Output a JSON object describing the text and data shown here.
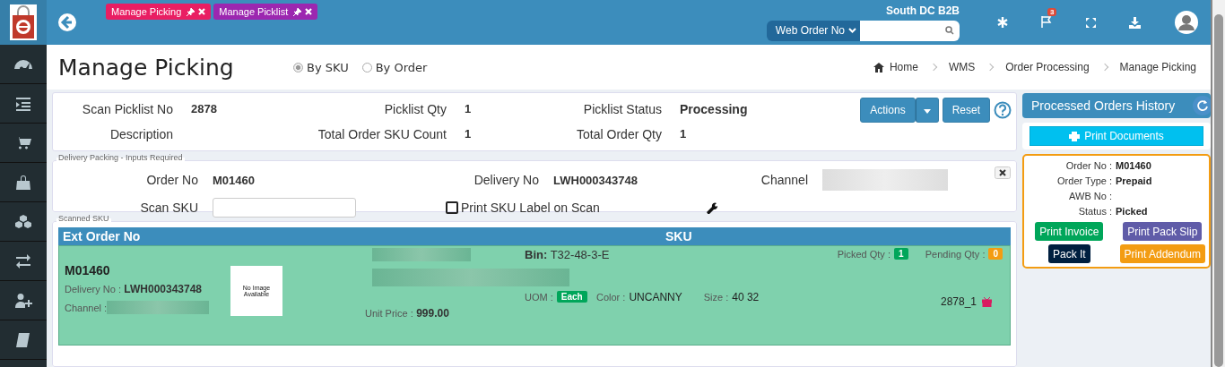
{
  "topbar": {
    "tabs": [
      {
        "label": "Manage Picking",
        "color": "#e91e63"
      },
      {
        "label": "Manage Picklist",
        "color": "#9c27b0"
      }
    ],
    "location": "South DC B2B",
    "search_type": "Web Order No",
    "notifications": "3"
  },
  "page_title": "Manage Picking",
  "mode": [
    {
      "label": "By SKU",
      "selected": true
    },
    {
      "label": "By Order",
      "selected": false
    }
  ],
  "breadcrumb": [
    "Home",
    "WMS",
    "Order Processing",
    "Manage Picking"
  ],
  "picklist": {
    "fields": [
      {
        "label": "Scan Picklist No",
        "value": "2878"
      },
      {
        "label": "Picklist Qty",
        "value": "1"
      },
      {
        "label": "Picklist Status",
        "value": "Processing"
      },
      {
        "label": "Description"
      },
      {
        "label": "Total Order SKU Count",
        "value": "1"
      },
      {
        "label": "Total Order Qty",
        "value": "1"
      }
    ],
    "actions": "Actions",
    "reset": "Reset"
  },
  "delivery": {
    "legend": "Delivery Packing - Inputs Required",
    "order_no_label": "Order No",
    "order_no": "M01460",
    "delivery_no_label": "Delivery No",
    "delivery_no": "LWH000343748",
    "channel_label": "Channel",
    "scan_sku_label": "Scan SKU",
    "print_label": {
      "label": "Print SKU Label on Scan",
      "checked": false
    }
  },
  "scanned": {
    "legend": "Scanned SKU",
    "columns": [
      "Ext Order No",
      "SKU"
    ],
    "row": {
      "order_no": "M01460",
      "delivery_label": "Delivery No :",
      "delivery_no": "LWH000343748",
      "channel_label": "Channel :",
      "image_text": "No Image Available",
      "bin_label": "Bin:",
      "bin": "T32-48-3-E",
      "uom_label": "UOM :",
      "uom": "Each",
      "price_label": "Unit Price :",
      "price": "999.00",
      "color_label": "Color :",
      "color_value": "UNCANNY",
      "size_label": "Size :",
      "size": "40 32",
      "picked_label": "Picked Qty :",
      "picked": "1",
      "pending_label": "Pending Qty :",
      "pending": "0",
      "ref": "2878_1"
    }
  },
  "history": {
    "title": "Processed Orders History",
    "print_documents": "Print Documents",
    "fields": [
      {
        "label": "Order No :",
        "value": "M01460"
      },
      {
        "label": "Order Type :",
        "value": "Prepaid"
      },
      {
        "label": "AWB No :"
      },
      {
        "label": "Status :",
        "value": "Picked"
      }
    ],
    "buttons": [
      {
        "label": "Print Invoice",
        "color": "#00a65a"
      },
      {
        "label": "Print Pack Slip",
        "color": "#605ca8"
      },
      {
        "label": "Pack It",
        "color": "#001f3f"
      },
      {
        "label": "Print Addendum",
        "color": "#f39c12"
      }
    ]
  }
}
